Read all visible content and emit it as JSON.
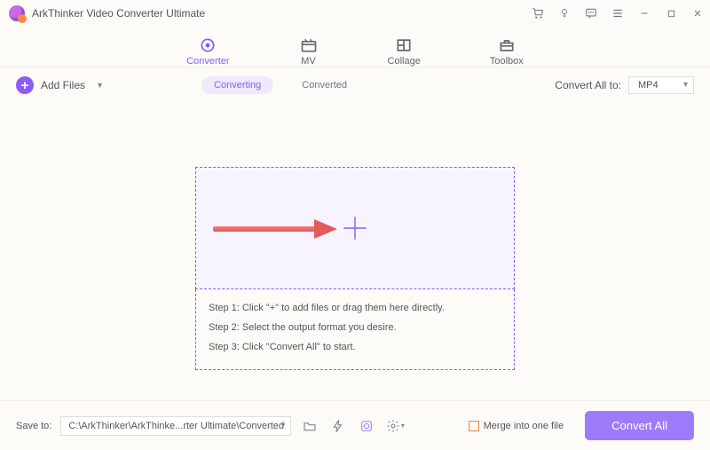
{
  "app": {
    "title": "ArkThinker Video Converter Ultimate"
  },
  "nav": {
    "converter": "Converter",
    "mv": "MV",
    "collage": "Collage",
    "toolbox": "Toolbox"
  },
  "toolbar": {
    "addFiles": "Add Files",
    "converting": "Converting",
    "converted": "Converted",
    "convertAllTo": "Convert All to:",
    "format": "MP4"
  },
  "steps": {
    "s1": "Step 1: Click \"+\" to add files or drag them here directly.",
    "s2": "Step 2: Select the output format you desire.",
    "s3": "Step 3: Click \"Convert All\" to start."
  },
  "bottom": {
    "saveTo": "Save to:",
    "path": "C:\\ArkThinker\\ArkThinke...rter Ultimate\\Converted",
    "merge": "Merge into one file",
    "convertAll": "Convert All"
  }
}
